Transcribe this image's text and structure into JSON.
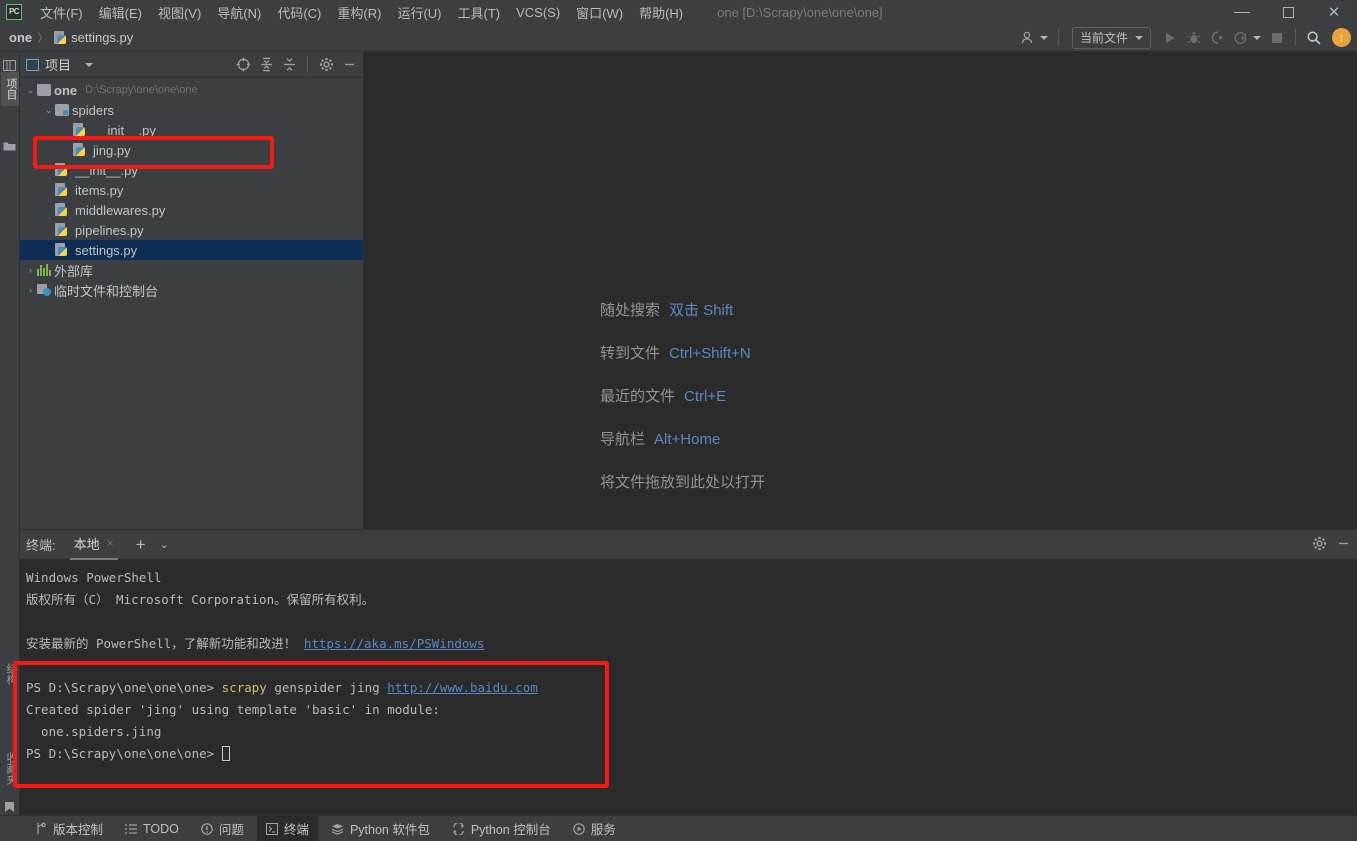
{
  "window": {
    "app_icon": "pycharm-logo",
    "title": "one [D:\\Scrapy\\one\\one\\one]",
    "controls": {
      "minimize": "minimize-icon",
      "maximize": "maximize-icon",
      "close": "close-icon"
    }
  },
  "menubar": {
    "items": [
      {
        "label": "文件(F)"
      },
      {
        "label": "编辑(E)"
      },
      {
        "label": "视图(V)"
      },
      {
        "label": "导航(N)"
      },
      {
        "label": "代码(C)"
      },
      {
        "label": "重构(R)"
      },
      {
        "label": "运行(U)"
      },
      {
        "label": "工具(T)"
      },
      {
        "label": "VCS(S)"
      },
      {
        "label": "窗口(W)"
      },
      {
        "label": "帮助(H)"
      }
    ]
  },
  "navbar": {
    "breadcrumb": {
      "project": "one",
      "separator": "〉",
      "file": "settings.py"
    },
    "toolbar": {
      "profiler_label": "",
      "run_config": "当前文件",
      "run_tooltip": "运行",
      "debug_tooltip": "调试",
      "coverage_tooltip": "运行覆盖率",
      "profile_tooltip": "性能分析",
      "stop_tooltip": "停止",
      "search_tooltip": "搜索",
      "update_badge": "↑"
    }
  },
  "left_strip": {
    "project_tab": "项目",
    "structure_tab": "结构",
    "favorites_tab": "收藏夹"
  },
  "project_panel": {
    "title": "项目",
    "tools": [
      {
        "name": "select-opened-file-icon",
        "glyph": "⊕"
      },
      {
        "name": "expand-all-icon",
        "glyph": "⨌"
      },
      {
        "name": "collapse-all-icon",
        "glyph": "⨋"
      },
      {
        "name": "settings-gear-icon",
        "glyph": "⚙"
      },
      {
        "name": "hide-panel-icon",
        "glyph": "—"
      }
    ],
    "tree": [
      {
        "label": "one",
        "path": "D:\\Scrapy\\one\\one\\one",
        "kind": "root",
        "indent": 0,
        "arrow": "⌄",
        "selected": false,
        "bold": true
      },
      {
        "label": "spiders",
        "path": "",
        "kind": "folder-src",
        "indent": 1,
        "arrow": "⌄",
        "selected": false,
        "bold": false
      },
      {
        "label": "__init__.py",
        "path": "",
        "kind": "py",
        "indent": 2,
        "arrow": "",
        "selected": false,
        "bold": false
      },
      {
        "label": "jing.py",
        "path": "",
        "kind": "py",
        "indent": 2,
        "arrow": "",
        "selected": false,
        "bold": false
      },
      {
        "label": "__init__.py",
        "path": "",
        "kind": "py",
        "indent": 1,
        "arrow": "",
        "selected": false,
        "bold": false
      },
      {
        "label": "items.py",
        "path": "",
        "kind": "py",
        "indent": 1,
        "arrow": "",
        "selected": false,
        "bold": false
      },
      {
        "label": "middlewares.py",
        "path": "",
        "kind": "py",
        "indent": 1,
        "arrow": "",
        "selected": false,
        "bold": false
      },
      {
        "label": "pipelines.py",
        "path": "",
        "kind": "py",
        "indent": 1,
        "arrow": "",
        "selected": false,
        "bold": false
      },
      {
        "label": "settings.py",
        "path": "",
        "kind": "py",
        "indent": 1,
        "arrow": "",
        "selected": true,
        "bold": false
      },
      {
        "label": "外部库",
        "path": "",
        "kind": "library",
        "indent": 0,
        "arrow": "›",
        "selected": false,
        "bold": false
      },
      {
        "label": "临时文件和控制台",
        "path": "",
        "kind": "scratch",
        "indent": 0,
        "arrow": "›",
        "selected": false,
        "bold": false
      }
    ]
  },
  "editor": {
    "welcome_shortcuts": [
      {
        "label": "随处搜索",
        "key": "双击 Shift"
      },
      {
        "label": "转到文件",
        "key": "Ctrl+Shift+N"
      },
      {
        "label": "最近的文件",
        "key": "Ctrl+E"
      },
      {
        "label": "导航栏",
        "key": "Alt+Home"
      },
      {
        "label": "将文件拖放到此处以打开",
        "key": ""
      }
    ]
  },
  "terminal": {
    "header_label": "终端:",
    "tab_label": "本地",
    "tab_close": "×",
    "add_label": "+",
    "chevron_label": "⌄",
    "settings_icon": "gear-icon",
    "hide_icon": "minimize-icon",
    "lines": [
      {
        "type": "plain",
        "text": "Windows PowerShell"
      },
      {
        "type": "plain",
        "text": "版权所有（C） Microsoft Corporation。保留所有权利。"
      },
      {
        "type": "blank",
        "text": ""
      },
      {
        "type": "link-line",
        "prefix": "安装最新的 PowerShell，了解新功能和改进！",
        "link": "https://aka.ms/PSWindows"
      },
      {
        "type": "blank",
        "text": ""
      },
      {
        "type": "prompt-cmd",
        "prompt": "PS D:\\Scrapy\\one\\one\\one> ",
        "cmd": "scrapy",
        "args": " genspider jing ",
        "link": "http://www.baidu.com"
      },
      {
        "type": "plain",
        "text": "Created spider 'jing' using template 'basic' in module:"
      },
      {
        "type": "plain",
        "text": "  one.spiders.jing"
      },
      {
        "type": "prompt-cursor",
        "prompt": "PS D:\\Scrapy\\one\\one\\one> "
      }
    ]
  },
  "annotations": {
    "tree_highlight_target": "jing.py",
    "terminal_highlight_target": "scrapy genspider command block",
    "color": "#f51b14"
  },
  "statusbar": {
    "items": [
      {
        "label": "版本控制",
        "icon": "branch-icon",
        "active": false
      },
      {
        "label": "TODO",
        "icon": "list-icon",
        "active": false
      },
      {
        "label": "问题",
        "icon": "warning-icon",
        "active": false
      },
      {
        "label": "终端",
        "icon": "terminal-icon",
        "active": true
      },
      {
        "label": "Python 软件包",
        "icon": "packages-icon",
        "active": false
      },
      {
        "label": "Python 控制台",
        "icon": "console-icon",
        "active": false
      },
      {
        "label": "服务",
        "icon": "services-icon",
        "active": false
      }
    ]
  }
}
